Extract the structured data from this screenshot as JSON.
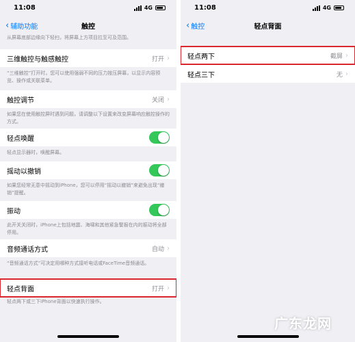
{
  "left": {
    "status": {
      "time": "11:08",
      "network": "4G"
    },
    "nav": {
      "back": "辅助功能",
      "title": "触控"
    },
    "top_footer": "从屏幕底部边缘向下轻扫，将屏幕上方项目拉至可及范围。",
    "rows": [
      {
        "label": "三维触控与触感触控",
        "value": "打开",
        "footer": "“三维触控”打开时，您可以使用强弱不同的压力按压屏幕，以显示内容预览、操作或关联菜单。"
      },
      {
        "label": "触控调节",
        "value": "关闭",
        "footer": "如果您在使用触控屏时遇到问题，请调整以下设置来改变屏幕响应触控操作的方式。"
      },
      {
        "label": "轻点唤醒",
        "toggle": "on",
        "footer": "轻点显示器时，唤醒屏幕。"
      },
      {
        "label": "摇动以撤销",
        "toggle": "on",
        "footer": "如果您经常无意中摇动到iPhone，您可以停用“摇动以撤销”来避免出现“撤销”提醒。"
      },
      {
        "label": "振动",
        "toggle": "on",
        "footer": "此开关关闭时，iPhone上包括地震、海啸和其他紧急警报在内的振动将全部停用。"
      },
      {
        "label": "音频通话方式",
        "value": "自动",
        "footer": "“音频通话方式”可决定用哪种方式接听电话或FaceTime音频通话。"
      },
      {
        "label": "轻点背面",
        "value": "打开",
        "footer": "轻点两下或三下iPhone背面以快速执行操作。"
      }
    ]
  },
  "right": {
    "status": {
      "time": "11:08",
      "network": "4G"
    },
    "nav": {
      "back": "触控",
      "title": "轻点背面"
    },
    "rows": [
      {
        "label": "轻点两下",
        "value": "截屏"
      },
      {
        "label": "轻点三下",
        "value": "无"
      }
    ]
  },
  "watermark": "广东龙网",
  "colors": {
    "accent": "#007aff",
    "toggle_on": "#34c759",
    "highlight": "#d9262c"
  }
}
